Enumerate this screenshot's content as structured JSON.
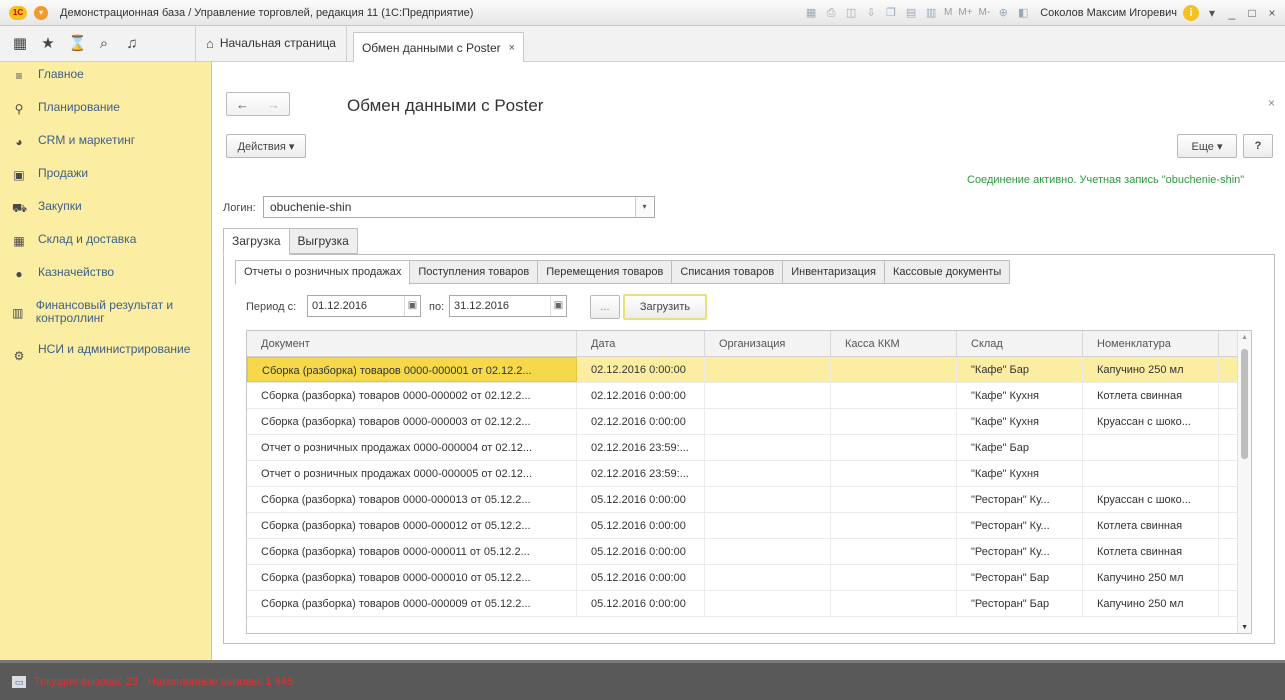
{
  "window": {
    "logo": "1C",
    "title": "Демонстрационная база / Управление торговлей, редакция 11  (1С:Предприятие)",
    "toolbar_m1": "M",
    "toolbar_m2": "M+",
    "toolbar_m3": "M-",
    "user": "Соколов Максим Игоревич",
    "info_glyph": "i",
    "min_glyph": "_",
    "max_glyph": "□",
    "close_glyph": "×"
  },
  "nav": {
    "home_label": "Начальная страница",
    "open_tab_label": "Обмен данными с Poster",
    "open_tab_close": "×"
  },
  "sidebar": {
    "items": [
      {
        "label": "Главное"
      },
      {
        "label": "Планирование"
      },
      {
        "label": "CRM и маркетинг"
      },
      {
        "label": "Продажи"
      },
      {
        "label": "Закупки"
      },
      {
        "label": "Склад и доставка"
      },
      {
        "label": "Казначейство"
      },
      {
        "label": "Финансовый результат и контроллинг"
      },
      {
        "label": "НСИ и администрирование"
      }
    ]
  },
  "form": {
    "title": "Обмен данными с Poster",
    "close_glyph": "×",
    "actions_label": "Действия ▾",
    "more_label": "Еще ▾",
    "help_label": "?",
    "status_msg": "Соединение активно. Учетная запись \"obuchenie-shin\"",
    "login_label": "Логин:",
    "login_value": "obuchenie-shin",
    "login_drop": "▾",
    "outer_tabs": [
      "Загрузка",
      "Выгрузка"
    ],
    "inner_tabs": [
      "Отчеты о розничных продажах",
      "Поступления товаров",
      "Перемещения товаров",
      "Списания товаров",
      "Инвентаризация",
      "Кассовые документы"
    ],
    "period_label": "Период с:",
    "date_from": "01.12.2016",
    "to_label": "по:",
    "date_to": "31.12.2016",
    "dots_label": "...",
    "load_label": "Загрузить"
  },
  "grid": {
    "columns": [
      "Документ",
      "Дата",
      "Организация",
      "Касса ККМ",
      "Склад",
      "Номенклатура"
    ],
    "rows": [
      [
        "Сборка (разборка) товаров 0000-000001 от 02.12.2...",
        "02.12.2016 0:00:00",
        "",
        "",
        "\"Кафе\" Бар",
        "Капучино 250 мл"
      ],
      [
        "Сборка (разборка) товаров 0000-000002 от 02.12.2...",
        "02.12.2016 0:00:00",
        "",
        "",
        "\"Кафе\" Кухня",
        "Котлета свинная"
      ],
      [
        "Сборка (разборка) товаров 0000-000003 от 02.12.2...",
        "02.12.2016 0:00:00",
        "",
        "",
        "\"Кафе\" Кухня",
        "Круассан с шоко..."
      ],
      [
        "Отчет о розничных продажах 0000-000004 от 02.12...",
        "02.12.2016 23:59:...",
        "",
        "",
        "\"Кафе\" Бар",
        ""
      ],
      [
        "Отчет о розничных продажах 0000-000005 от 02.12...",
        "02.12.2016 23:59:...",
        "",
        "",
        "\"Кафе\" Кухня",
        ""
      ],
      [
        "Сборка (разборка) товаров 0000-000013 от 05.12.2...",
        "05.12.2016 0:00:00",
        "",
        "",
        "\"Ресторан\" Ку...",
        "Круассан с шоко..."
      ],
      [
        "Сборка (разборка) товаров 0000-000012 от 05.12.2...",
        "05.12.2016 0:00:00",
        "",
        "",
        "\"Ресторан\" Ку...",
        "Котлета свинная"
      ],
      [
        "Сборка (разборка) товаров 0000-000011 от 05.12.2...",
        "05.12.2016 0:00:00",
        "",
        "",
        "\"Ресторан\" Ку...",
        "Котлета свинная"
      ],
      [
        "Сборка (разборка) товаров 0000-000010 от 05.12.2...",
        "05.12.2016 0:00:00",
        "",
        "",
        "\"Ресторан\" Бар",
        "Капучино 250 мл"
      ],
      [
        "Сборка (разборка) товаров 0000-000009 от 05.12.2...",
        "05.12.2016 0:00:00",
        "",
        "",
        "\"Ресторан\" Бар",
        "Капучино 250 мл"
      ]
    ]
  },
  "statusbar": {
    "current_calls": "Текущие вызовы: 23",
    "total_calls": "Накопленные вызовы: 1 845"
  },
  "colors": {
    "sidebar_bg": "#fbeda1",
    "selected_cell": "#f6d94a",
    "status_green": "#2a9a3a",
    "calls_red": "#e03030"
  }
}
